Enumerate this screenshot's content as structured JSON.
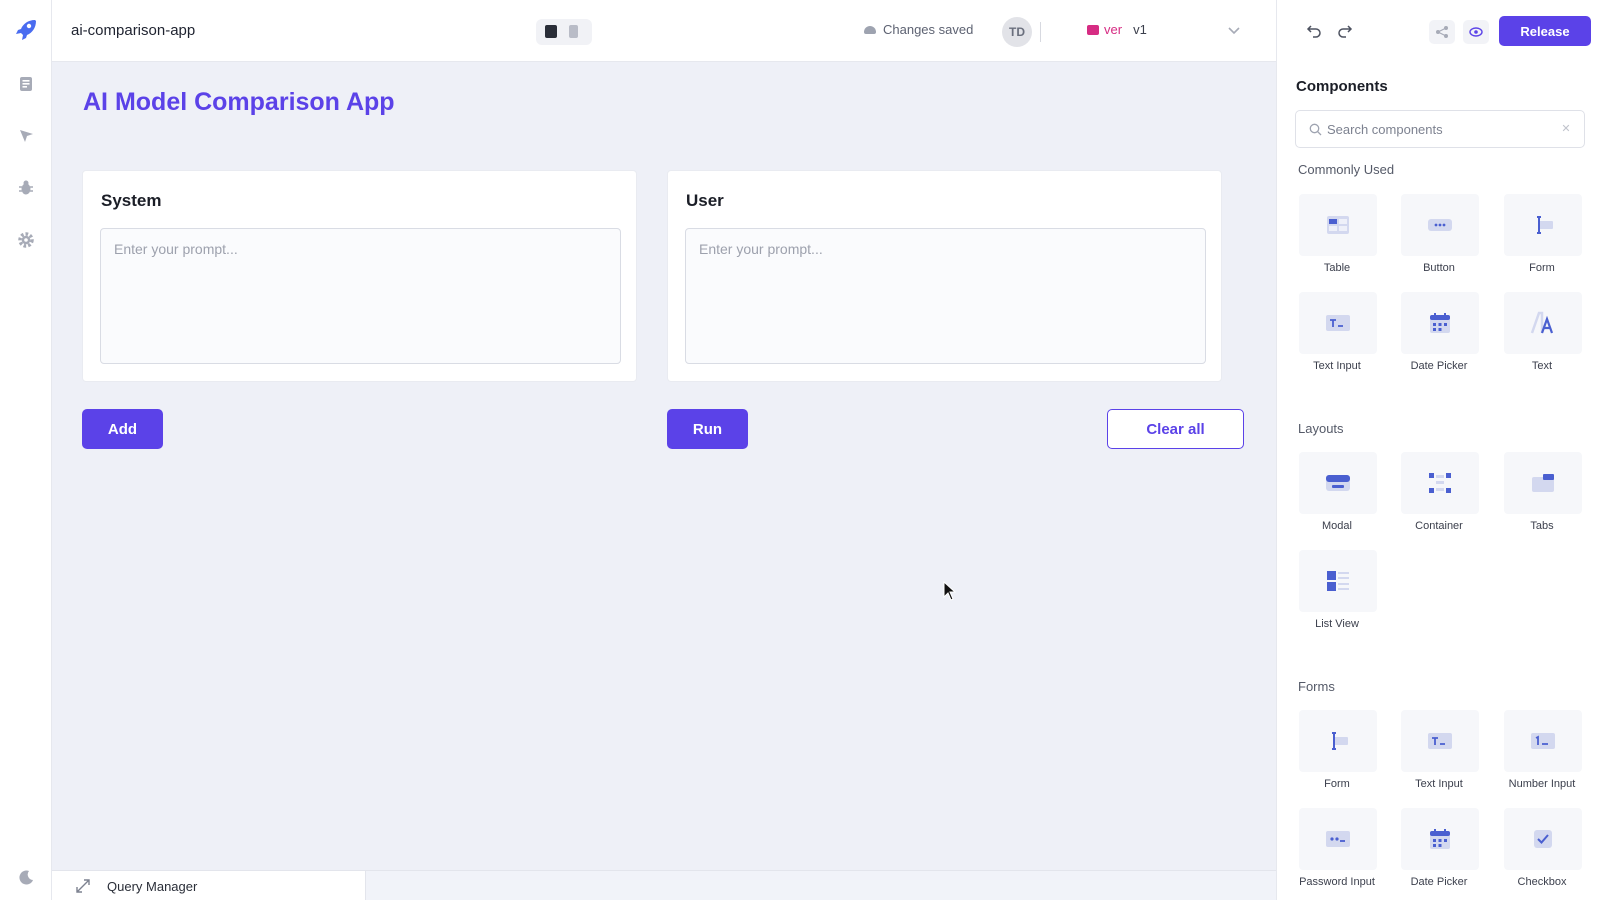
{
  "app": {
    "name": "ai-comparison-app"
  },
  "topbar": {
    "saved_status": "Changes saved",
    "avatar_initials": "TD",
    "version_label": "ver",
    "version_value": "v1"
  },
  "page": {
    "title": "AI Model Comparison App",
    "system_card": {
      "title": "System",
      "placeholder": "Enter your prompt...",
      "value": ""
    },
    "user_card": {
      "title": "User",
      "placeholder": "Enter your prompt...",
      "value": ""
    },
    "add_label": "Add",
    "run_label": "Run",
    "clear_label": "Clear all"
  },
  "bottombar": {
    "query_manager_label": "Query Manager"
  },
  "rightpanel": {
    "release_label": "Release",
    "title": "Components",
    "search_placeholder": "Search components",
    "sections": {
      "common": {
        "label": "Commonly Used",
        "items": [
          "Table",
          "Button",
          "Form",
          "Text Input",
          "Date Picker",
          "Text"
        ]
      },
      "layouts": {
        "label": "Layouts",
        "items": [
          "Modal",
          "Container",
          "Tabs",
          "List View"
        ]
      },
      "forms": {
        "label": "Forms",
        "items": [
          "Form",
          "Text Input",
          "Number Input",
          "Password Input",
          "Date Picker",
          "Checkbox"
        ]
      }
    }
  },
  "colors": {
    "accent": "#5b42e8",
    "version_pink": "#d62c83",
    "canvas_bg": "#eef0f7"
  }
}
